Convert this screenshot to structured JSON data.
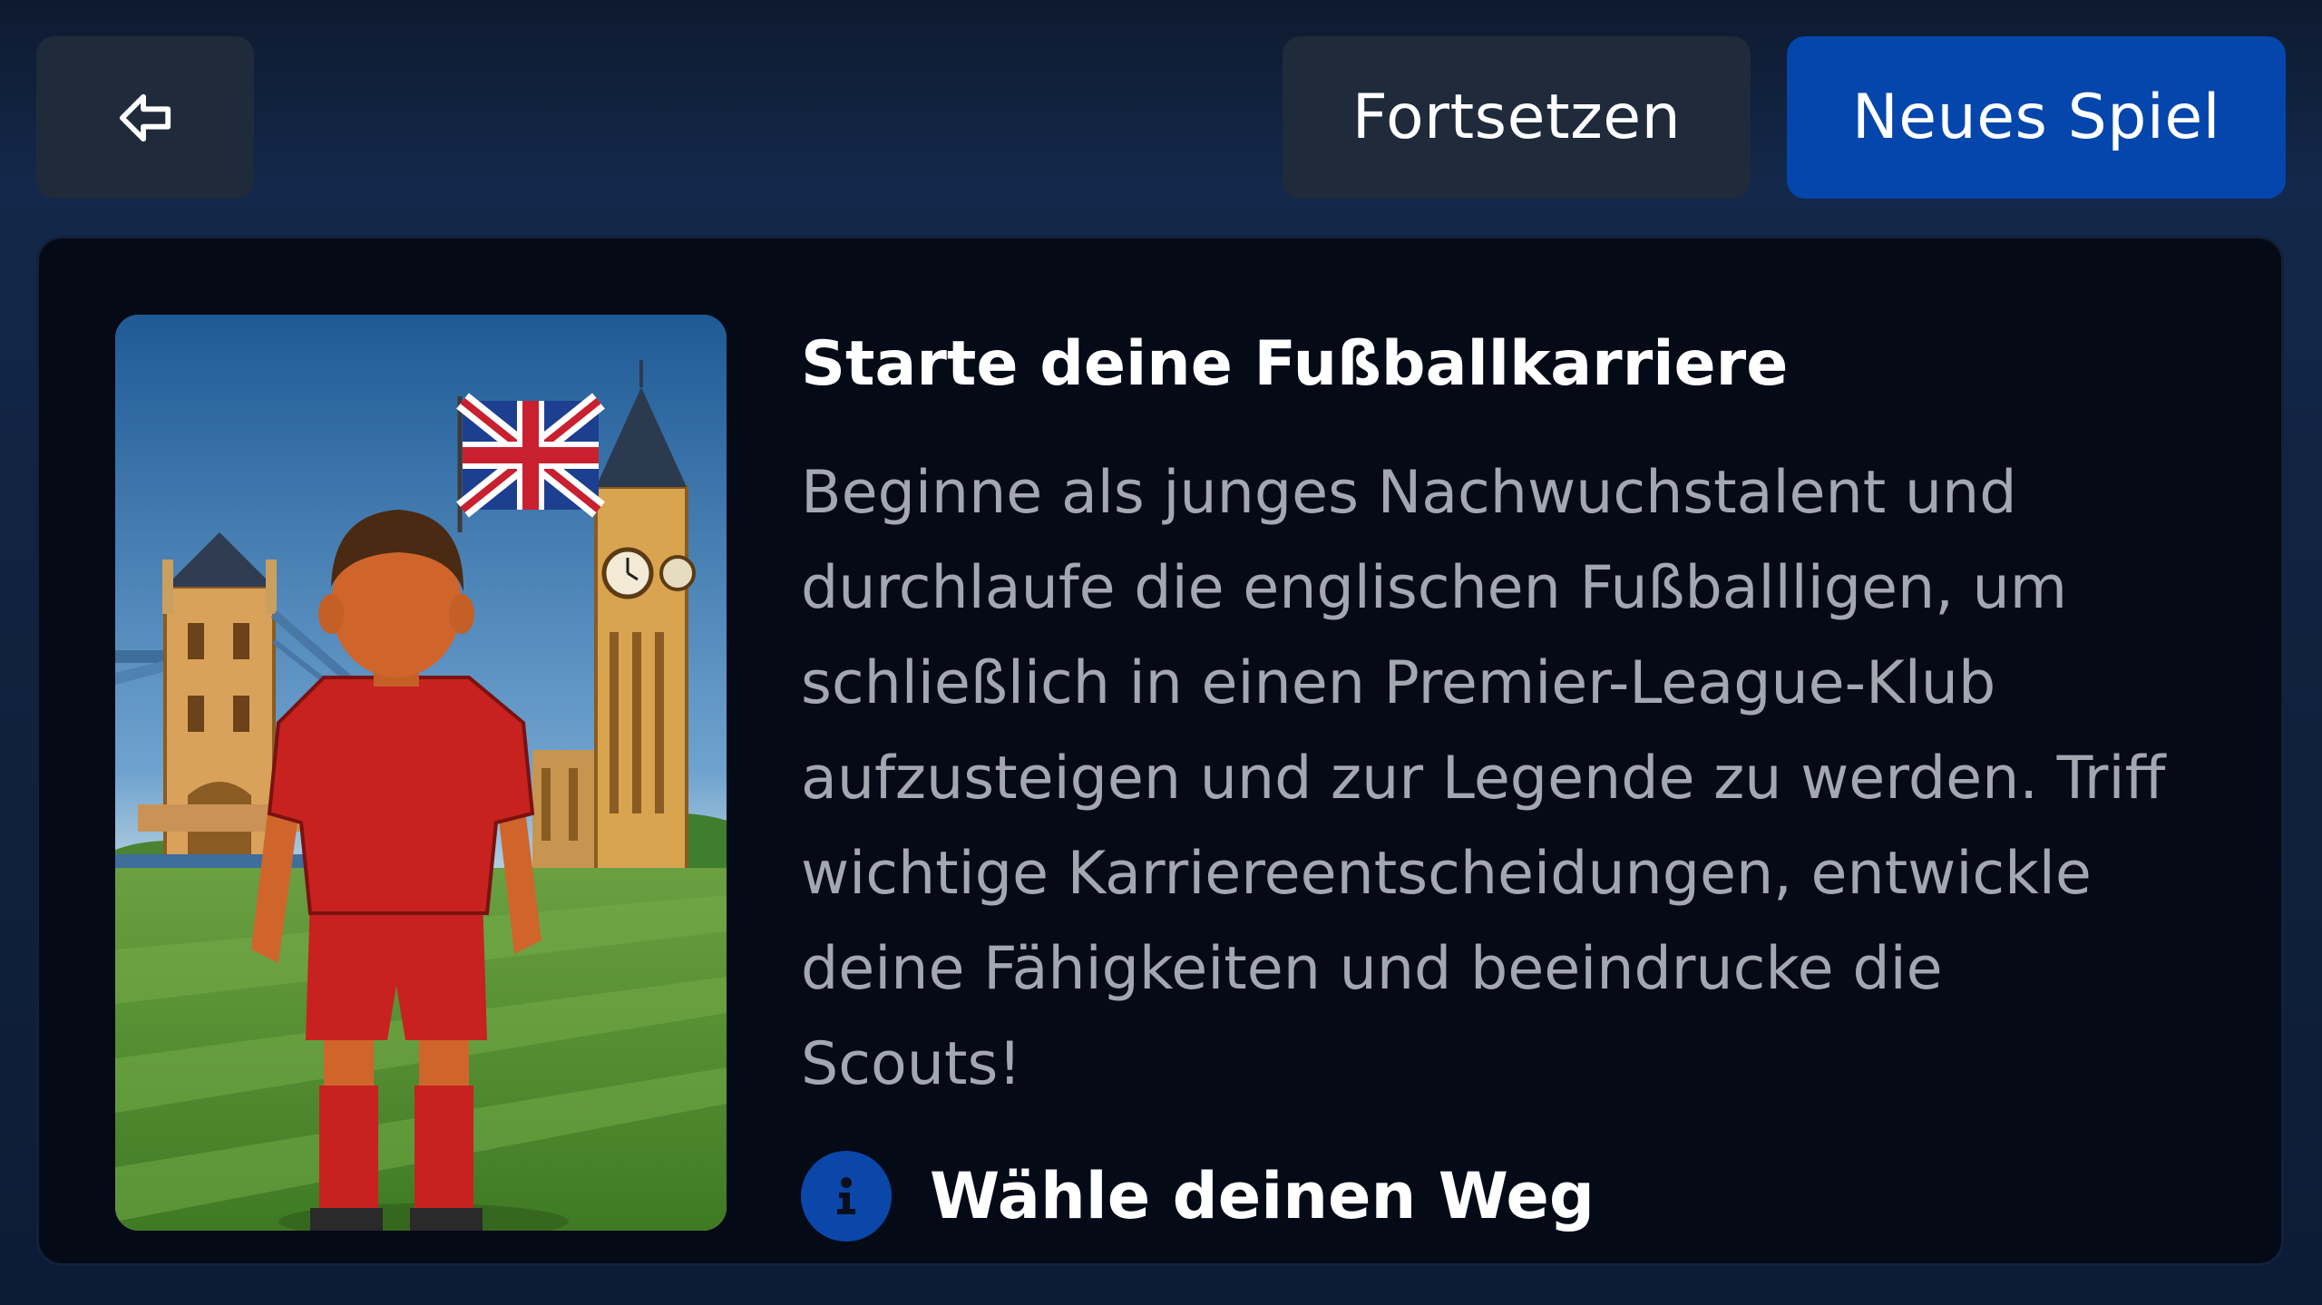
{
  "toolbar": {
    "back_icon": "arrow-left-icon",
    "continue_label": "Fortsetzen",
    "new_game_label": "Neues Spiel"
  },
  "career_card": {
    "title": "Starte deine Fußballkarriere",
    "description": "Beginne als junges Nachwuchstalent und durchlaufe die englischen Fußballligen, um schließlich in einen Premier-League-Klub aufzusteigen und zur Legende zu werden. Triff wichtige Karriereentscheidungen, entwickle deine Fähigkeiten und beeindrucke die Scouts!",
    "info_icon": "info-icon",
    "info_label": "Wähle deinen Weg"
  },
  "colors": {
    "background": "#0f1c33",
    "button_secondary": "#1f2a3b",
    "button_primary": "#0546ad",
    "card_background": "#050a17",
    "title_text": "#ffffff",
    "description_text": "#a3a7b0",
    "info_badge": "#0a47a8"
  }
}
